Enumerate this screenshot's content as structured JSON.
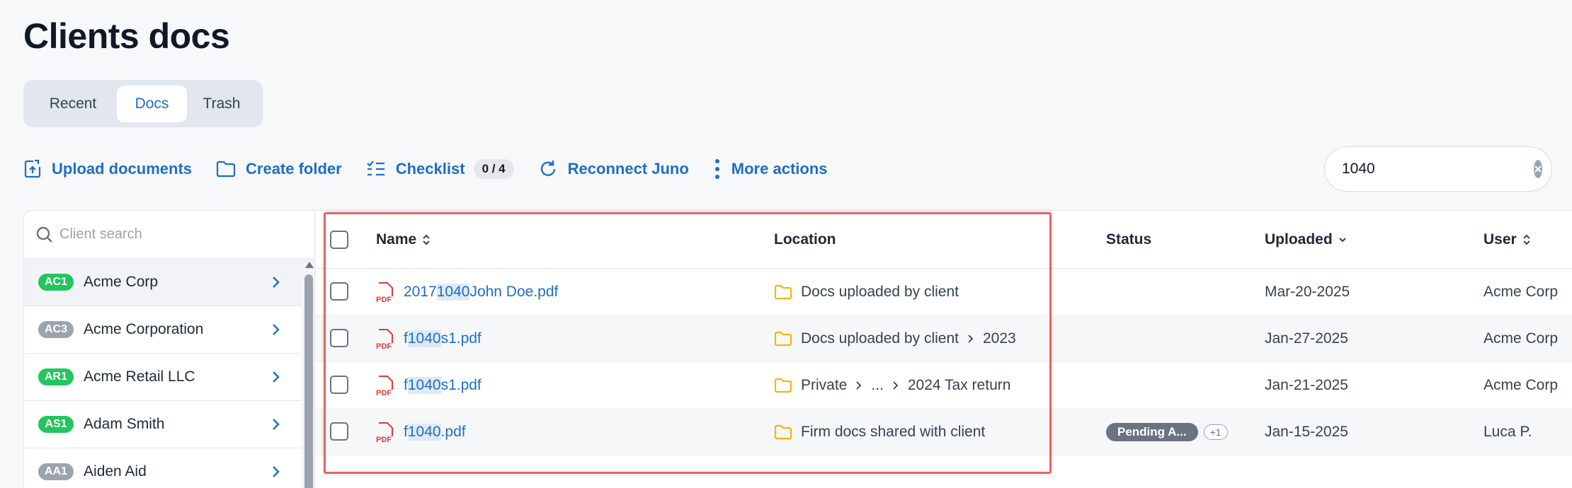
{
  "page": {
    "title": "Clients docs"
  },
  "tabs": [
    {
      "label": "Recent"
    },
    {
      "label": "Docs"
    },
    {
      "label": "Trash"
    }
  ],
  "toolbar": {
    "upload": "Upload documents",
    "create_folder": "Create folder",
    "checklist": "Checklist",
    "checklist_count": "0 / 4",
    "reconnect": "Reconnect Juno",
    "more_actions": "More actions"
  },
  "search": {
    "value": "1040"
  },
  "clients": {
    "search_placeholder": "Client search",
    "items": [
      {
        "code": "AC1",
        "name": "Acme Corp",
        "code_color": "green"
      },
      {
        "code": "AC3",
        "name": "Acme Corporation",
        "code_color": "gray"
      },
      {
        "code": "AR1",
        "name": "Acme Retail LLC",
        "code_color": "green"
      },
      {
        "code": "AS1",
        "name": "Adam Smith",
        "code_color": "green"
      },
      {
        "code": "AA1",
        "name": "Aiden Aid",
        "code_color": "gray"
      }
    ]
  },
  "table": {
    "columns": {
      "name": "Name",
      "location": "Location",
      "status": "Status",
      "uploaded": "Uploaded",
      "user": "User"
    },
    "rows": [
      {
        "name_pre": "2017 ",
        "name_hl": "1040",
        "name_post": " John Doe.pdf",
        "location": [
          "Docs uploaded by client"
        ],
        "status": "",
        "status_extra": "",
        "uploaded": "Mar-20-2025",
        "user": "Acme Corp"
      },
      {
        "name_pre": "f",
        "name_hl": "1040",
        "name_post": "s1.pdf",
        "location": [
          "Docs uploaded by client",
          "2023"
        ],
        "status": "",
        "status_extra": "",
        "uploaded": "Jan-27-2025",
        "user": "Acme Corp"
      },
      {
        "name_pre": "f",
        "name_hl": "1040",
        "name_post": "s1.pdf",
        "location": [
          "Private",
          "...",
          "2024 Tax return"
        ],
        "status": "",
        "status_extra": "",
        "uploaded": "Jan-21-2025",
        "user": "Acme Corp"
      },
      {
        "name_pre": "f",
        "name_hl": "1040",
        "name_post": ".pdf",
        "location": [
          "Firm docs shared with client"
        ],
        "status": "Pending A...",
        "status_extra": "+1",
        "uploaded": "Jan-15-2025",
        "user": "Luca P."
      }
    ]
  },
  "colors": {
    "accent": "#1d6fc4",
    "pdf": "#e53935",
    "folder": "#f5b800",
    "highlight_box": "#e5655e",
    "client_green": "#22c55e"
  },
  "icons": {
    "upload": "upload-icon",
    "folder": "folder-icon",
    "checklist": "checklist-icon",
    "reconnect": "refresh-icon",
    "more": "vertical-dots-icon",
    "search": "search-icon",
    "clear": "clear-icon",
    "pdf": "pdf-icon",
    "chevron": "chevron-right-icon",
    "sort": "sort-icon"
  }
}
